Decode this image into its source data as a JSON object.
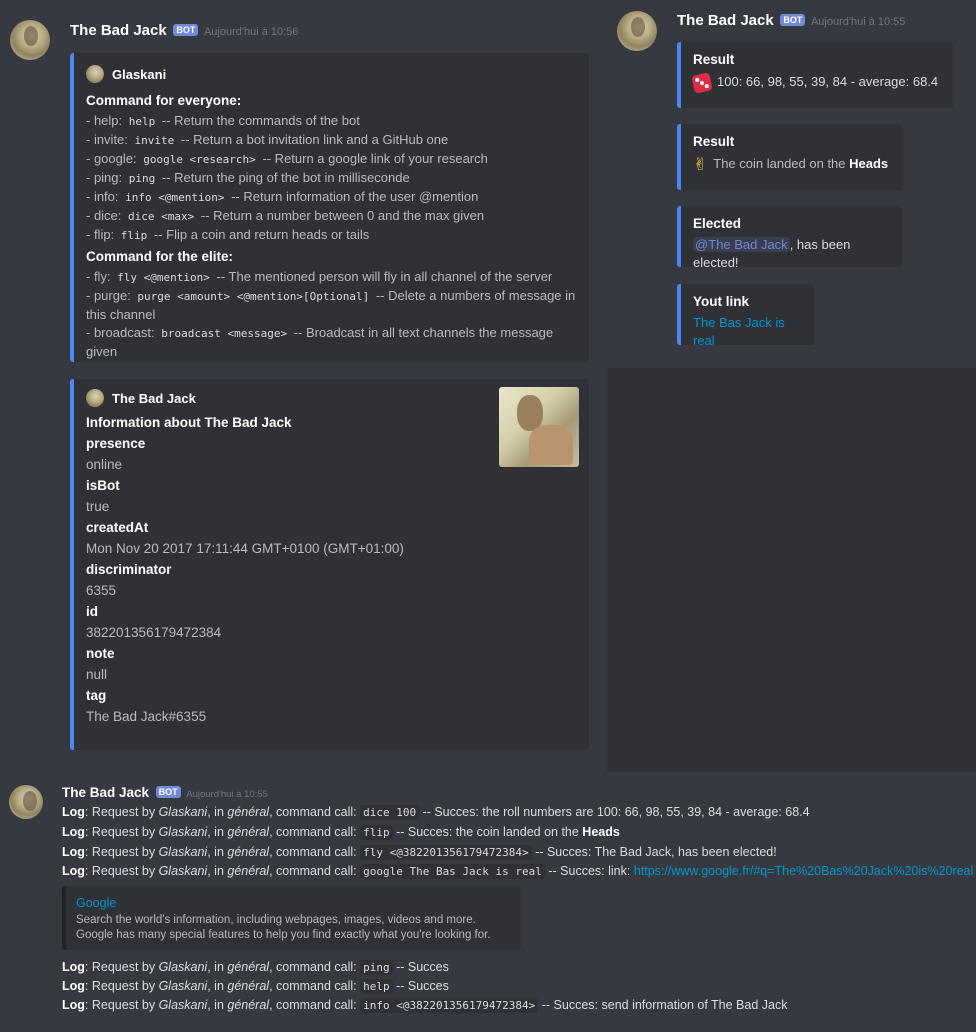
{
  "bot_label": "BOT",
  "colors": {
    "background": "#36393f",
    "embed_bg": "#2f3136",
    "accent": "#4f86f7",
    "badge": "#7289da",
    "link": "#0096cf"
  },
  "message1": {
    "username": "The Bad Jack",
    "timestamp": "Aujourd'hui à 10:56",
    "help_embed": {
      "author": "Glaskani",
      "section1_title": "Command for everyone:",
      "everyone": [
        {
          "pre": "- help: ",
          "code": "help",
          "post": " -- Return the commands of the bot"
        },
        {
          "pre": "- invite: ",
          "code": "invite",
          "post": " -- Return a bot invitation link and a GitHub one"
        },
        {
          "pre": "- google: ",
          "code": "google <research>",
          "post": " -- Return a google link of your research"
        },
        {
          "pre": "- ping: ",
          "code": "ping",
          "post": " -- Return the ping of the bot in milliseconde"
        },
        {
          "pre": "- info: ",
          "code": "info <@mention>",
          "post": " -- Return information of the user @mention"
        },
        {
          "pre": "- dice: ",
          "code": "dice <max>",
          "post": " -- Return a number between 0 and the max given"
        },
        {
          "pre": "- flip: ",
          "code": "flip",
          "post": " -- Flip a coin and return heads or tails"
        }
      ],
      "section2_title": "Command for the elite:",
      "elite": [
        {
          "pre": "- fly: ",
          "code": "fly <@mention>",
          "post": " -- The mentioned person will fly in all channel of the server"
        },
        {
          "pre": "- purge: ",
          "code": "purge <amount> <@mention>[Optional]",
          "post": " -- Delete a numbers of message in this channel"
        },
        {
          "pre": "- broadcast: ",
          "code": "broadcast <message>",
          "post": " -- Broadcast in all text channels the message given"
        }
      ]
    },
    "info_embed": {
      "author": "The Bad Jack",
      "title": "Information about The Bad Jack",
      "fields": [
        {
          "name": "presence",
          "value": "online"
        },
        {
          "name": "isBot",
          "value": "true"
        },
        {
          "name": "createdAt",
          "value": "Mon Nov 20 2017 17:11:44 GMT+0100 (GMT+01:00)"
        },
        {
          "name": "discriminator",
          "value": "6355"
        },
        {
          "name": "id",
          "value": "382201356179472384"
        },
        {
          "name": "note",
          "value": "null"
        },
        {
          "name": "tag",
          "value": "The Bad Jack#6355"
        }
      ]
    }
  },
  "message2": {
    "username": "The Bad Jack",
    "timestamp": "Aujourd'hui à 10:55",
    "embeds": {
      "result1_title": "Result",
      "result1_text": "100: 66, 98, 55, 39, 84 - average: 68.4",
      "result2_title": "Result",
      "result2_text_pre": "The coin landed on the ",
      "result2_text_bold": "Heads",
      "elected_title": "Elected",
      "elected_mention": "@The Bad Jack",
      "elected_text": ", has been elected!",
      "link_title": "Yout link",
      "link_text": "The Bas Jack is real"
    }
  },
  "message3": {
    "username": "The Bad Jack",
    "timestamp": "Aujourd'hui à 10:55",
    "log_label": "Log",
    "request_by": ": Request by ",
    "user": "Glaskani",
    "in_text": ", in ",
    "channel": "général",
    "command_call": ", command call: ",
    "logs": [
      {
        "code": "dice 100",
        "result": " -- Succes: the roll numbers are 100: 66, 98, 55, 39, 84 - average: 68.4",
        "bold": "",
        "link": ""
      },
      {
        "code": "flip",
        "result": " -- Succes: the coin landed on the ",
        "bold": "Heads",
        "link": ""
      },
      {
        "code": "fly <@382201356179472384>",
        "result": " -- Succes: The Bad Jack, has been elected!",
        "bold": "",
        "link": ""
      },
      {
        "code": "google The Bas Jack is real",
        "result": " -- Succes: link: ",
        "bold": "",
        "link": "https://www.google.fr/#q=The%20Bas%20Jack%20is%20real"
      },
      {
        "code": "ping",
        "result": " -- Succes",
        "bold": "",
        "link": ""
      },
      {
        "code": "help",
        "result": " -- Succes",
        "bold": "",
        "link": ""
      },
      {
        "code": "info <@382201356179472384>",
        "result": " -- Succes: send information of The Bad Jack",
        "bold": "",
        "link": ""
      }
    ],
    "link_embed": {
      "title": "Google",
      "description": "Search the world's information, including webpages, images, videos and more. Google has many special features to help you find exactly what you're looking for."
    }
  }
}
